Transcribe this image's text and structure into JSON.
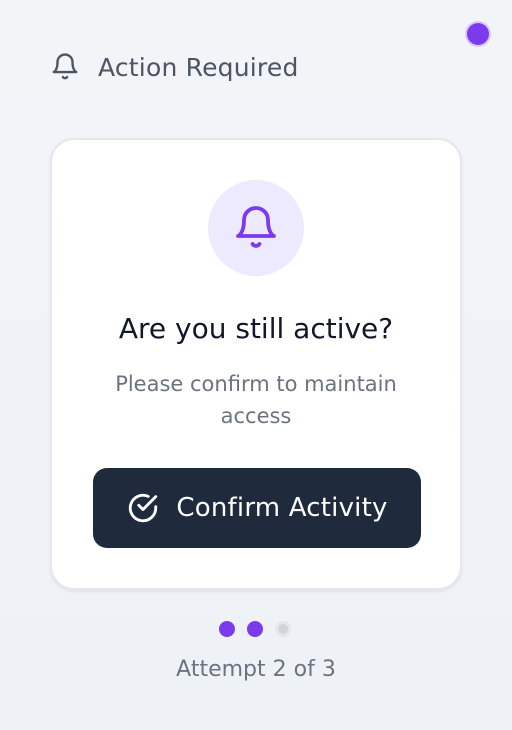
{
  "status": {
    "indicator_color": "#7c3aed"
  },
  "header": {
    "icon": "bell-icon",
    "title": "Action Required"
  },
  "card": {
    "icon": "bell-icon",
    "title": "Are you still active?",
    "subtitle": "Please confirm to maintain access",
    "button": {
      "icon": "check-circle-icon",
      "label": "Confirm Activity"
    }
  },
  "progress": {
    "current_attempt": 2,
    "total_attempts": 3,
    "dots": [
      {
        "state": "active"
      },
      {
        "state": "active"
      },
      {
        "state": "inactive"
      }
    ],
    "label": "Attempt 2 of 3"
  },
  "colors": {
    "accent": "#7c3aed",
    "button_background": "#1f2a3d",
    "icon_background": "#ede9fe"
  }
}
